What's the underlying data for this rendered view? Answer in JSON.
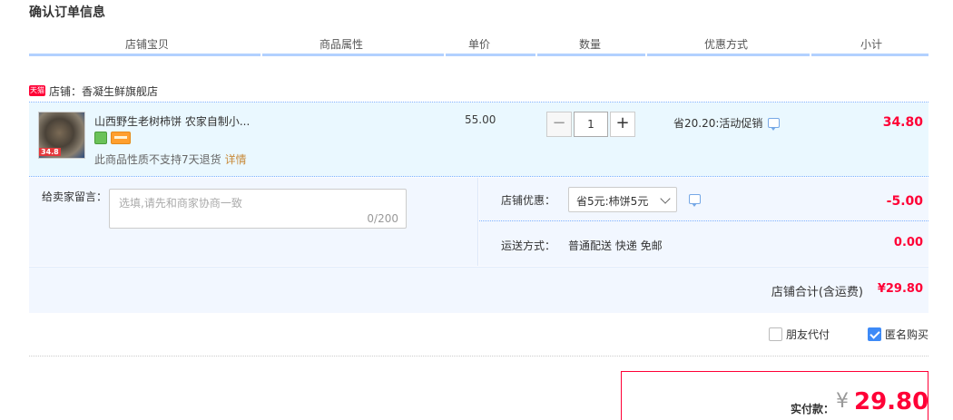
{
  "page": {
    "title": "确认订单信息"
  },
  "columns": [
    "店铺宝贝",
    "商品属性",
    "单价",
    "数量",
    "优惠方式",
    "小计"
  ],
  "shop": {
    "badge": "天猫",
    "label": "店铺：香凝生鲜旗舰店"
  },
  "item": {
    "thumb_badge": "34.8",
    "title": "山西野生老树柿饼 农家自制小...",
    "no_return": "此商品性质不支持7天退货",
    "detail_link": "详情",
    "unit_price": "55.00",
    "quantity": "1",
    "qty_minus": "−",
    "qty_plus": "+",
    "promo": "省20.20:活动促销",
    "subtotal": "34.80"
  },
  "message": {
    "label": "给卖家留言：",
    "placeholder": "选填,请先和商家协商一致",
    "count": "0/200"
  },
  "shop_discount": {
    "label": "店铺优惠：",
    "selected": "省5元:柿饼5元",
    "value": "-5.00"
  },
  "shipping": {
    "label": "运送方式：",
    "value": "普通配送 快递 免邮",
    "fee": "0.00"
  },
  "shop_total": {
    "label": "店铺合计(含运费)",
    "value": "¥29.80"
  },
  "options": {
    "friend_pay": "朋友代付",
    "anonymous": "匿名购买",
    "anonymous_checked": true
  },
  "payment": {
    "label": "实付款：",
    "currency": "¥",
    "amount": "29.80"
  },
  "colors": {
    "accent": "#ff0036",
    "border": "#80b2ff",
    "bg_item": "#eaf8ff"
  }
}
